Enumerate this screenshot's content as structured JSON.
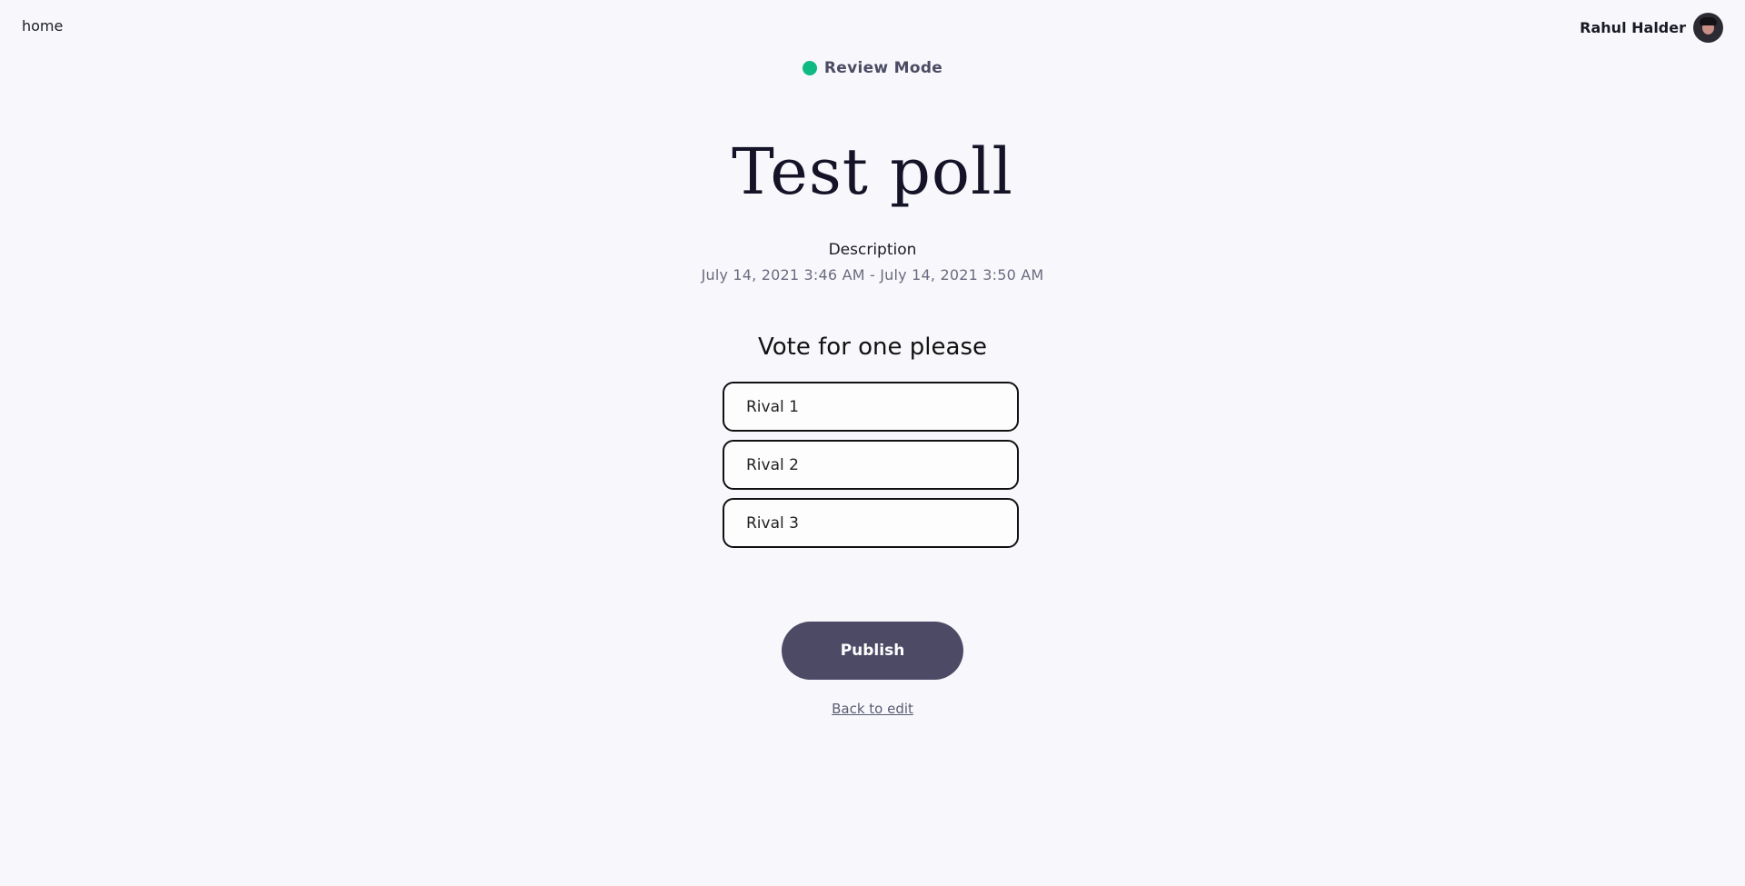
{
  "nav": {
    "home_label": "home"
  },
  "user": {
    "name": "Rahul Halder"
  },
  "mode": {
    "label": "Review Mode",
    "dot_color": "#10b981"
  },
  "poll": {
    "title": "Test poll",
    "description": "Description",
    "dates": "July 14, 2021 3:46 AM - July 14, 2021 3:50 AM",
    "prompt": "Vote for one please",
    "options": [
      "Rival 1",
      "Rival 2",
      "Rival 3"
    ]
  },
  "actions": {
    "publish_label": "Publish",
    "back_label": "Back to edit",
    "publish_color": "#4d4a66"
  }
}
